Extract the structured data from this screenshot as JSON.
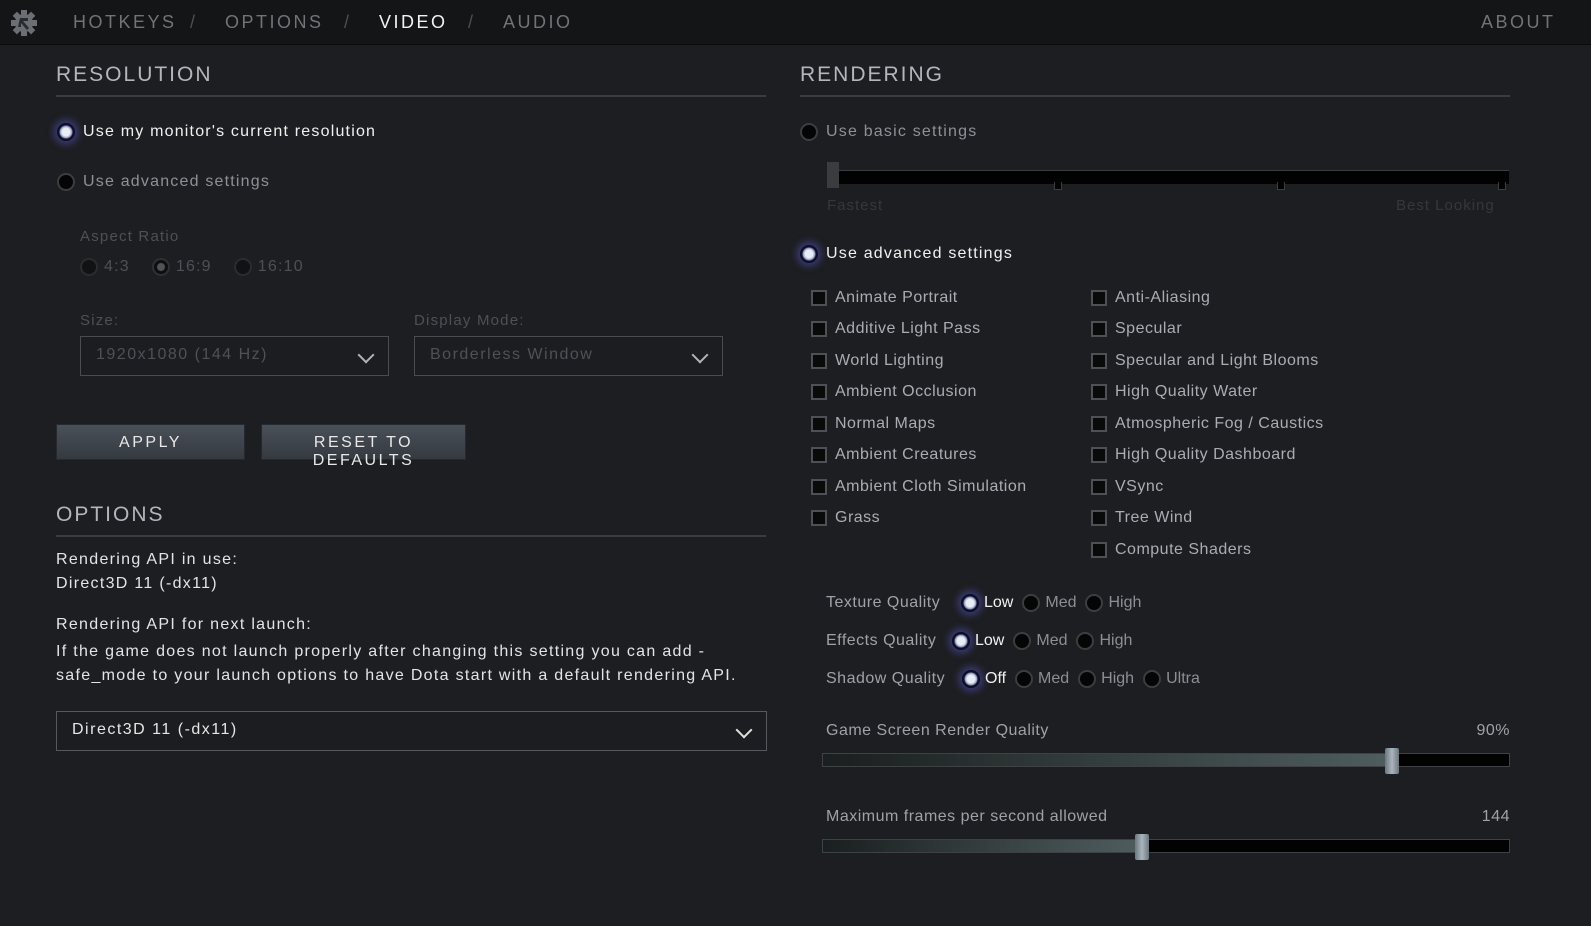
{
  "nav": {
    "tabs": [
      "HOTKEYS",
      "OPTIONS",
      "VIDEO",
      "AUDIO"
    ],
    "active": "VIDEO",
    "separator": "/",
    "about": "ABOUT"
  },
  "resolution": {
    "title": "RESOLUTION",
    "opt_current": "Use my monitor's current resolution",
    "opt_advanced": "Use advanced settings",
    "aspect_label": "Aspect Ratio",
    "aspects": [
      "4:3",
      "16:9",
      "16:10"
    ],
    "aspect_selected": "16:9",
    "size_label": "Size:",
    "size_value": "1920x1080 (144 Hz)",
    "mode_label": "Display Mode:",
    "mode_value": "Borderless Window",
    "apply": "APPLY",
    "reset": "RESET TO DEFAULTS"
  },
  "options": {
    "title": "OPTIONS",
    "api_in_use_label": "Rendering API in use:",
    "api_in_use": "Direct3D 11 (-dx11)",
    "api_next_label": "Rendering API for next launch:",
    "api_note": "If the game does not launch properly after changing this setting you can add -safe_mode to your launch options to have Dota start with a default rendering API.",
    "api_select": "Direct3D 11 (-dx11)"
  },
  "rendering": {
    "title": "RENDERING",
    "basic": "Use basic settings",
    "basic_min": "Fastest",
    "basic_max": "Best Looking",
    "basic_level": 0,
    "advanced": "Use advanced settings",
    "checks_left": [
      "Animate Portrait",
      "Additive Light Pass",
      "World Lighting",
      "Ambient Occlusion",
      "Normal Maps",
      "Ambient Creatures",
      "Ambient Cloth Simulation",
      "Grass"
    ],
    "checks_right": [
      "Anti-Aliasing",
      "Specular",
      "Specular and Light Blooms",
      "High Quality Water",
      "Atmospheric Fog / Caustics",
      "High Quality Dashboard",
      "VSync",
      "Tree Wind",
      "Compute Shaders"
    ],
    "texture": {
      "label": "Texture Quality",
      "options": [
        "Low",
        "Med",
        "High"
      ]
    },
    "effects": {
      "label": "Effects Quality",
      "options": [
        "Low",
        "Med",
        "High"
      ]
    },
    "shadow": {
      "label": "Shadow Quality",
      "options": [
        "Off",
        "Med",
        "High",
        "Ultra"
      ]
    },
    "render_quality": {
      "label": "Game Screen Render Quality",
      "value": "90%",
      "fraction": 0.83
    },
    "fps": {
      "label": "Maximum frames per second allowed",
      "value": "144",
      "fraction": 0.465
    }
  }
}
